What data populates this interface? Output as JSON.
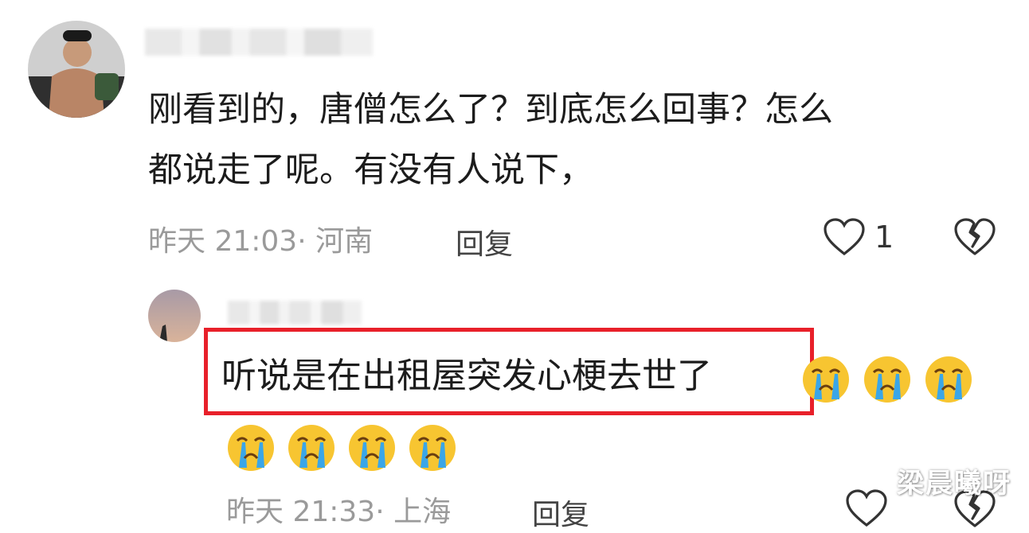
{
  "comments": [
    {
      "text": "刚看到的，唐僧怎么了？到底怎么回事？怎么\n都说走了呢。有没有人说下，",
      "meta": "昨天 21:03· 河南",
      "reply_label": "回复",
      "like_count": "1"
    }
  ],
  "reply": {
    "highlighted_text": "听说是在出租屋突发心梗去世了",
    "emoji_name": "loudly-crying-face-emoji",
    "meta": "昨天 21:33· 上海",
    "reply_label": "回复"
  },
  "watermark": "梁晨曦呀",
  "colors": {
    "highlight_border": "#e8202a",
    "meta_text": "#9a9a9a",
    "emoji_face": "#f7c531",
    "emoji_tears": "#3aa6e8"
  }
}
